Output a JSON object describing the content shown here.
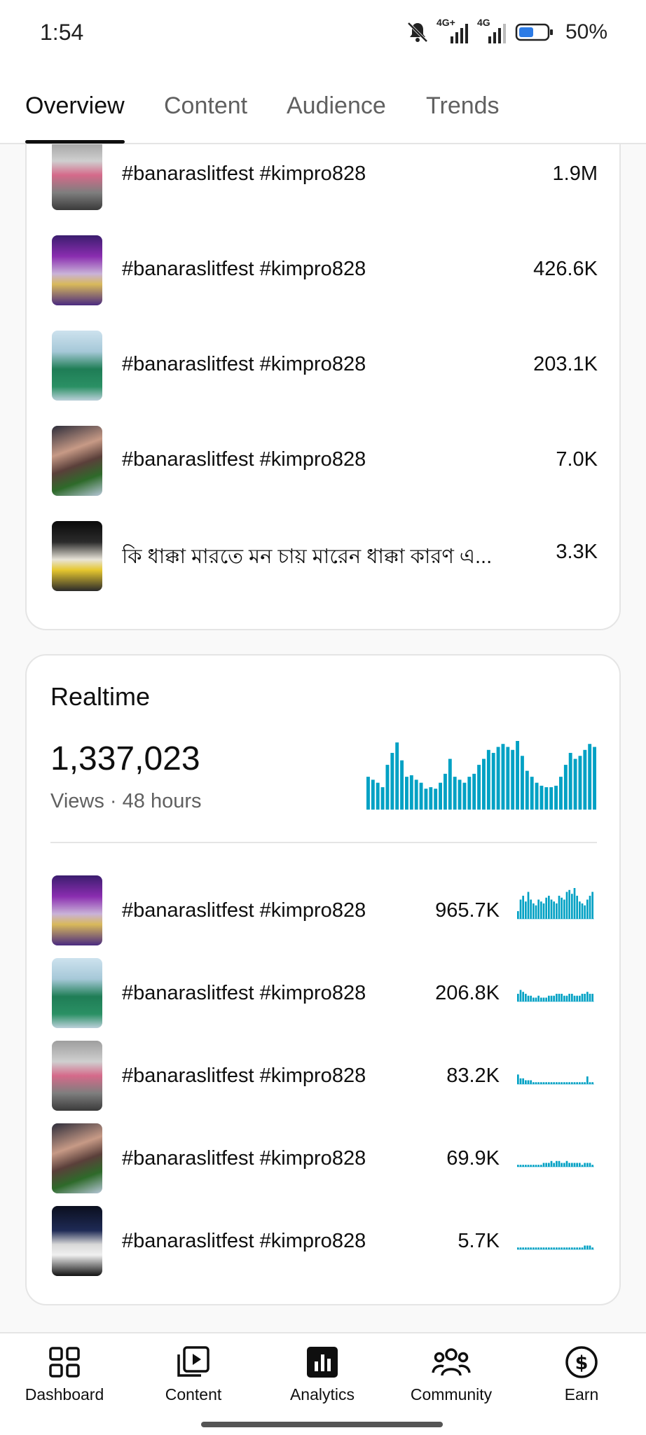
{
  "status_bar": {
    "time": "1:54",
    "network_1": "4G+",
    "network_2": "4G",
    "battery": "50%"
  },
  "tabs": [
    {
      "label": "Overview",
      "active": true
    },
    {
      "label": "Content",
      "active": false
    },
    {
      "label": "Audience",
      "active": false
    },
    {
      "label": "Trends",
      "active": false
    }
  ],
  "top_content": {
    "items": [
      {
        "title": "#banaraslitfest #kimpro828",
        "value": "1.9M",
        "thumb": "girl-train-station"
      },
      {
        "title": "#banaraslitfest #kimpro828",
        "value": "426.6K",
        "thumb": "man-purple-stage"
      },
      {
        "title": "#banaraslitfest #kimpro828",
        "value": "203.1K",
        "thumb": "girl-green-outfit"
      },
      {
        "title": "#banaraslitfest #kimpro828",
        "value": "7.0K",
        "thumb": "man-closeup"
      },
      {
        "title": "কি ধাক্কা মারতে মন চায় মারেন ধাক্কা কারণ এ...",
        "value": "3.3K",
        "thumb": "crowd-night"
      }
    ]
  },
  "realtime": {
    "title": "Realtime",
    "views": "1,337,023",
    "views_label": "Views",
    "period": "48 hours",
    "hourly_views": [
      22,
      20,
      18,
      15,
      30,
      38,
      45,
      33,
      22,
      23,
      20,
      18,
      14,
      15,
      14,
      18,
      24,
      34,
      22,
      20,
      18,
      22,
      24,
      30,
      34,
      40,
      38,
      42,
      44,
      42,
      40,
      46,
      36,
      26,
      22,
      18,
      16,
      15,
      15,
      16,
      22,
      30,
      38,
      34,
      36,
      40,
      44,
      42
    ],
    "items": [
      {
        "title": "#banaraslitfest #kimpro828",
        "value": "965.7K",
        "thumb": "man-purple-stage",
        "trend": [
          4,
          10,
          12,
          9,
          14,
          10,
          8,
          7,
          10,
          9,
          8,
          11,
          12,
          10,
          9,
          8,
          12,
          11,
          10,
          14,
          15,
          13,
          16,
          12,
          9,
          8,
          7,
          10,
          12,
          14
        ]
      },
      {
        "title": "#banaraslitfest #kimpro828",
        "value": "206.8K",
        "thumb": "girl-green-outfit",
        "trend": [
          4,
          6,
          5,
          4,
          3,
          3,
          2,
          2,
          3,
          2,
          2,
          2,
          3,
          3,
          3,
          4,
          4,
          4,
          3,
          3,
          4,
          4,
          3,
          3,
          3,
          4,
          4,
          5,
          4,
          4
        ]
      },
      {
        "title": "#banaraslitfest #kimpro828",
        "value": "83.2K",
        "thumb": "girl-train-station",
        "trend": [
          5,
          3,
          3,
          2,
          2,
          2,
          1,
          1,
          1,
          1,
          1,
          1,
          1,
          1,
          1,
          1,
          1,
          1,
          1,
          1,
          1,
          1,
          1,
          1,
          1,
          1,
          1,
          4,
          1,
          1
        ]
      },
      {
        "title": "#banaraslitfest #kimpro828",
        "value": "69.9K",
        "thumb": "man-closeup",
        "trend": [
          1,
          1,
          1,
          1,
          1,
          1,
          1,
          1,
          1,
          1,
          2,
          2,
          2,
          3,
          2,
          3,
          3,
          2,
          2,
          3,
          2,
          2,
          2,
          2,
          2,
          1,
          2,
          2,
          2,
          1
        ]
      },
      {
        "title": "#banaraslitfest #kimpro828",
        "value": "5.7K",
        "thumb": "phone-hand-dark",
        "trend": [
          1,
          1,
          1,
          1,
          1,
          1,
          1,
          1,
          1,
          1,
          1,
          1,
          1,
          1,
          1,
          1,
          1,
          1,
          1,
          1,
          1,
          1,
          1,
          1,
          1,
          1,
          2,
          2,
          2,
          1
        ]
      }
    ]
  },
  "bottom_nav": [
    {
      "label": "Dashboard",
      "icon": "dashboard-icon",
      "active": false
    },
    {
      "label": "Content",
      "icon": "content-icon",
      "active": false
    },
    {
      "label": "Analytics",
      "icon": "analytics-icon",
      "active": true
    },
    {
      "label": "Community",
      "icon": "community-icon",
      "active": false
    },
    {
      "label": "Earn",
      "icon": "earn-icon",
      "active": false
    }
  ],
  "colors": {
    "accent": "#0f0f0f",
    "chart": "#00a1c4",
    "muted_text": "#606060",
    "divider": "#e5e5e5"
  }
}
